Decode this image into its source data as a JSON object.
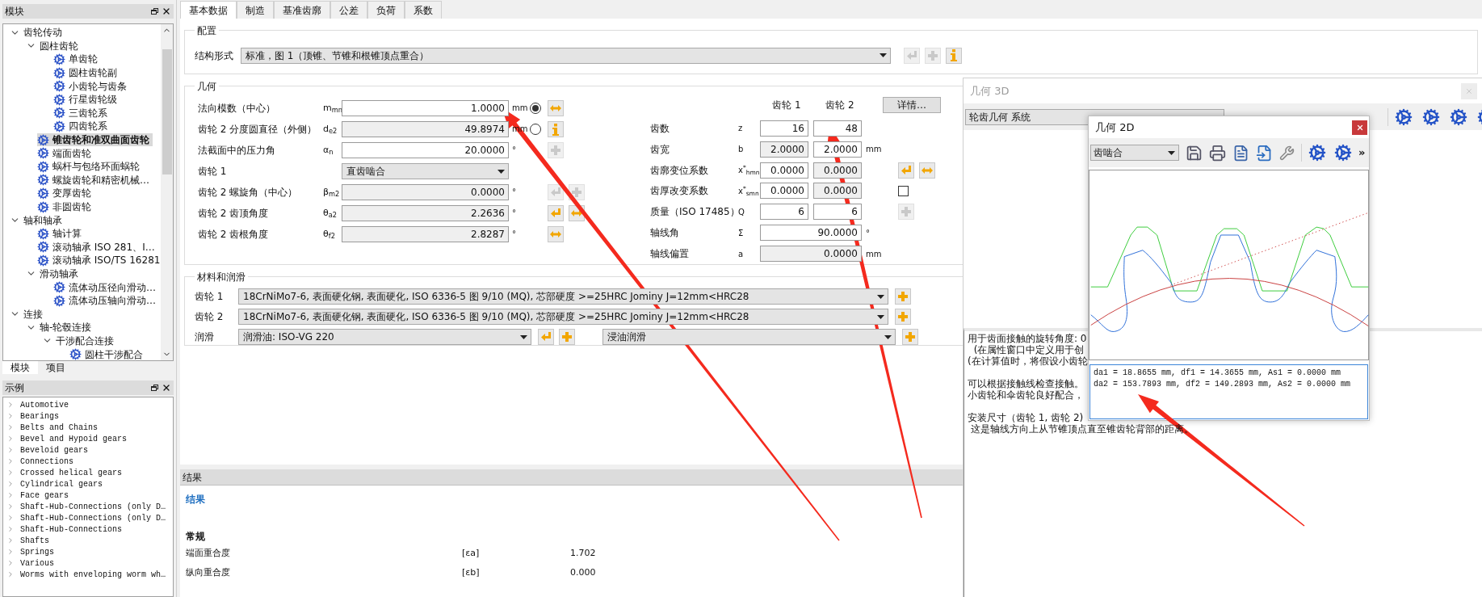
{
  "modules_panel": {
    "title": "模块",
    "tree": [
      {
        "label": "齿轮传动",
        "expanded": true,
        "selected": false,
        "children": [
          {
            "label": "圆柱齿轮",
            "expanded": true,
            "selected": false,
            "children": [
              {
                "label": "单齿轮",
                "selected": false
              },
              {
                "label": "圆柱齿轮副",
                "selected": false
              },
              {
                "label": "小齿轮与齿条",
                "selected": false
              },
              {
                "label": "行星齿轮级",
                "selected": false
              },
              {
                "label": "三齿轮系",
                "selected": false
              },
              {
                "label": "四齿轮系",
                "selected": false
              }
            ]
          },
          {
            "label": "锥齿轮和准双曲面齿轮",
            "selected": true
          },
          {
            "label": "端面齿轮",
            "selected": false
          },
          {
            "label": "蜗杆与包络环面蜗轮",
            "selected": false
          },
          {
            "label": "螺旋齿轮和精密机械…",
            "selected": false
          },
          {
            "label": "变厚齿轮",
            "selected": false
          },
          {
            "label": "非圆齿轮",
            "selected": false
          }
        ]
      },
      {
        "label": "轴和轴承",
        "expanded": true,
        "selected": false,
        "children": [
          {
            "label": "轴计算",
            "selected": false
          },
          {
            "label": "滚动轴承 ISO 281、I…",
            "selected": false
          },
          {
            "label": "滚动轴承 ISO/TS 16281",
            "selected": false
          },
          {
            "label": "滑动轴承",
            "expanded": true,
            "selected": false,
            "children": [
              {
                "label": "流体动压径向滑动…",
                "selected": false
              },
              {
                "label": "流体动压轴向滑动…",
                "selected": false
              }
            ]
          }
        ]
      },
      {
        "label": "连接",
        "expanded": true,
        "selected": false,
        "children": [
          {
            "label": "轴-轮毂连接",
            "expanded": true,
            "selected": false,
            "children": [
              {
                "label": "干涉配合连接",
                "expanded": true,
                "selected": false,
                "children": [
                  {
                    "label": "圆柱干涉配合",
                    "selected": false
                  }
                ]
              }
            ]
          }
        ]
      }
    ],
    "tabs": [
      {
        "label": "模块",
        "selected": true
      },
      {
        "label": "项目",
        "selected": false
      }
    ]
  },
  "examples_panel": {
    "title": "示例",
    "items": [
      "Automotive",
      "Bearings",
      "Belts and Chains",
      "Bevel and Hypoid gears",
      "Beveloid gears",
      "Connections",
      "Crossed helical gears",
      "Cylindrical gears",
      "Face gears",
      "Shaft-Hub-Connections (only D…",
      "Shaft-Hub-Connections (only D…",
      "Shaft-Hub-Connections",
      "Shafts",
      "Springs",
      "Various",
      "Worms with enveloping worm wh…"
    ]
  },
  "tabs": [
    {
      "label": "基本数据",
      "selected": true
    },
    {
      "label": "制造",
      "selected": false
    },
    {
      "label": "基准齿廓",
      "selected": false
    },
    {
      "label": "公差",
      "selected": false
    },
    {
      "label": "负荷",
      "selected": false
    },
    {
      "label": "系数",
      "selected": false
    }
  ],
  "configuration": {
    "title": "配置",
    "label": "结构形式",
    "value": "标准，图 1（顶锥、节锥和根锥顶点重合）",
    "buttons": [
      {
        "kind": "return",
        "disabled": true
      },
      {
        "kind": "plus",
        "disabled": true
      },
      {
        "kind": "info",
        "disabled": false
      }
    ]
  },
  "geometry": {
    "title": "几何",
    "left_rows": [
      {
        "kind": "number",
        "label": "法向模数（中心）",
        "symbol": "m$_{mn}$",
        "value": "1.0000",
        "editable": true,
        "unit": "mm",
        "radio_selected": true,
        "buttons": [
          {
            "kind": "swap",
            "disabled": false
          }
        ]
      },
      {
        "kind": "number",
        "label": "齿轮 2 分度圆直径（外侧）",
        "symbol": "d$_{e2}$",
        "value": "49.8974",
        "editable": false,
        "unit": "mm",
        "radio_selected": false,
        "buttons": [
          {
            "kind": "info",
            "disabled": false
          }
        ]
      },
      {
        "kind": "number",
        "label": "法截面中的压力角",
        "symbol": "α$_{n}$",
        "value": "20.0000",
        "editable": true,
        "unit": "°",
        "buttons": [
          {
            "kind": "plus",
            "disabled": true
          }
        ]
      },
      {
        "kind": "select",
        "label": "齿轮 1",
        "value": "直齿啮合"
      },
      {
        "kind": "number",
        "label": "齿轮 2 螺旋角（中心）",
        "symbol": "β$_{m2}$",
        "value": "0.0000",
        "editable": false,
        "unit": "°",
        "buttons": [
          {
            "kind": "return",
            "disabled": true
          },
          {
            "kind": "plus",
            "disabled": true
          }
        ]
      },
      {
        "kind": "number",
        "label": "齿轮 2 齿顶角度",
        "symbol": "θ$_{a2}$",
        "value": "2.2636",
        "editable": false,
        "unit": "°",
        "buttons": [
          {
            "kind": "return",
            "disabled": false
          },
          {
            "kind": "swap",
            "disabled": false
          }
        ]
      },
      {
        "kind": "number",
        "label": "齿轮 2 齿根角度",
        "symbol": "θ$_{f2}$",
        "value": "2.8287",
        "editable": false,
        "unit": "°",
        "buttons": [
          {
            "kind": "swap",
            "disabled": false
          }
        ]
      }
    ],
    "gear_headers": [
      "齿轮 1",
      "齿轮 2"
    ],
    "details_button": "详情…",
    "right_rows": [
      {
        "kind": "pair",
        "label": "齿数",
        "symbol": "z",
        "fields": [
          {
            "value": "16",
            "editable": true
          },
          {
            "value": "48",
            "editable": true
          }
        ]
      },
      {
        "kind": "pair",
        "label": "齿宽",
        "symbol": "b",
        "fields": [
          {
            "value": "2.0000",
            "editable": false
          },
          {
            "value": "2.0000",
            "editable": true
          }
        ],
        "unit": "mm"
      },
      {
        "kind": "pair",
        "label": "齿廓变位系数",
        "symbol": "x$^{*}$$_{hmn}$",
        "fields": [
          {
            "value": "0.0000",
            "editable": true
          },
          {
            "value": "0.0000",
            "editable": false
          }
        ],
        "buttons": [
          {
            "kind": "return",
            "disabled": false
          },
          {
            "kind": "swap",
            "disabled": false
          }
        ]
      },
      {
        "kind": "pair",
        "label": "齿厚改变系数",
        "symbol": "x$^{*}$$_{smn}$",
        "fields": [
          {
            "value": "0.0000",
            "editable": true
          },
          {
            "value": "0.0000",
            "editable": false
          }
        ],
        "checked": false
      },
      {
        "kind": "pair",
        "label": "质量（ISO 17485）",
        "symbol": "Q",
        "fields": [
          {
            "value": "6",
            "editable": true
          },
          {
            "value": "6",
            "editable": true
          }
        ],
        "buttons": [
          {
            "kind": "plus",
            "disabled": true
          }
        ]
      },
      {
        "kind": "wide",
        "label": "轴线角",
        "symbol": "Σ",
        "fields": [
          {
            "value": "90.0000",
            "editable": true
          }
        ],
        "unit": "°"
      },
      {
        "kind": "wide",
        "label": "轴线偏置",
        "symbol": "a",
        "fields": [
          {
            "value": "0.0000",
            "editable": false
          }
        ],
        "unit": "mm"
      }
    ]
  },
  "materials": {
    "title": "材料和润滑",
    "rows": [
      {
        "label": "齿轮 1",
        "selects": [
          {
            "value": "18CrNiMo7-6, 表面硬化钢, 表面硬化, ISO 6336-5 图 9/10 (MQ), 芯部硬度 >=25HRC Jominy J=12mm<HRC28",
            "buttons": [
              {
                "kind": "plus",
                "disabled": false
              }
            ]
          }
        ]
      },
      {
        "label": "齿轮 2",
        "selects": [
          {
            "value": "18CrNiMo7-6, 表面硬化钢, 表面硬化, ISO 6336-5 图 9/10 (MQ), 芯部硬度 >=25HRC Jominy J=12mm<HRC28",
            "buttons": [
              {
                "kind": "plus",
                "disabled": false
              }
            ]
          }
        ]
      },
      {
        "label": "润滑",
        "selects": [
          {
            "value": "润滑油: ISO-VG 220",
            "buttons": [
              {
                "kind": "return",
                "disabled": false
              },
              {
                "kind": "plus",
                "disabled": false
              }
            ]
          },
          {
            "value": "浸油润滑",
            "buttons": [
              {
                "kind": "plus",
                "disabled": false
              }
            ]
          }
        ]
      }
    ]
  },
  "results": {
    "title": "结果",
    "link": "结果",
    "section": "常规",
    "rows": [
      {
        "label": "端面重合度",
        "symbol": "[εa]",
        "value": "1.702"
      },
      {
        "label": "纵向重合度",
        "symbol": "[εb]",
        "value": "0.000"
      }
    ]
  },
  "window_3d": {
    "title": "几何 3D",
    "active": false,
    "dropdown": "轮齿几何 系统",
    "paragraphs": [
      [
        "用于齿面接触的旋转角度: 0",
        "  (在属性窗口中定义用于创",
        "(在计算值时，将假设小齿轮"
      ],
      [
        "可以根据接触线检查接触。",
        "小齿轮和伞齿轮良好配合，"
      ],
      [
        "安装尺寸（齿轮 1, 齿轮 2)",
        " 这是轴线方向上从节锥顶点直至锥齿轮背部的距离。"
      ]
    ]
  },
  "window_2d": {
    "title": "几何 2D",
    "active": true,
    "dropdown": "齿啮合",
    "more": "»",
    "info_lines": [
      "da1 = 18.8655 mm, df1 = 14.3655 mm, As1 = 0.0000 mm",
      "da2 = 153.7893 mm, df2 = 149.2893 mm, As2 = 0.0000 mm"
    ]
  }
}
